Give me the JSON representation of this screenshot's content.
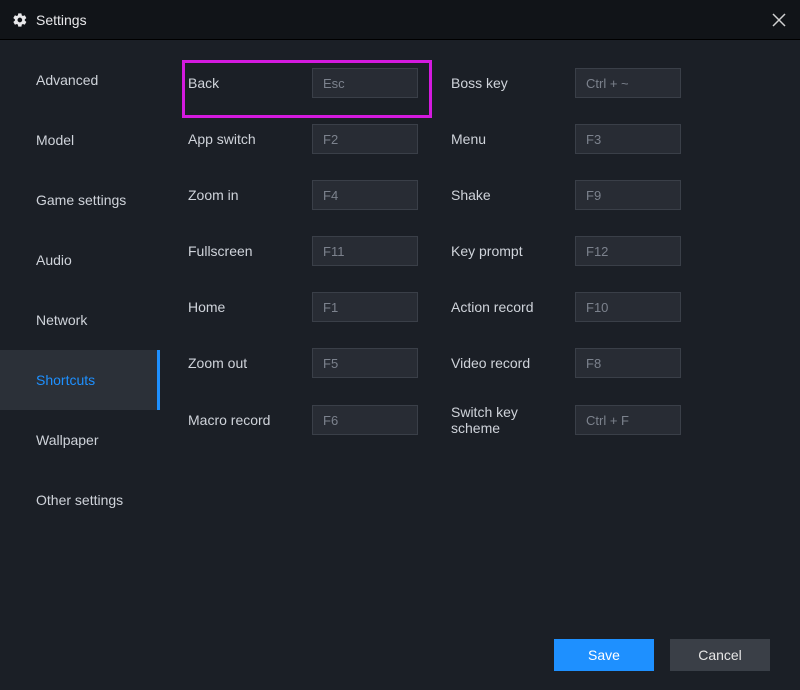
{
  "titlebar": {
    "title": "Settings"
  },
  "sidebar": {
    "items": [
      {
        "label": "Advanced"
      },
      {
        "label": "Model"
      },
      {
        "label": "Game settings"
      },
      {
        "label": "Audio"
      },
      {
        "label": "Network"
      },
      {
        "label": "Shortcuts"
      },
      {
        "label": "Wallpaper"
      },
      {
        "label": "Other settings"
      }
    ],
    "active_index": 5
  },
  "shortcuts": {
    "back": {
      "label": "Back",
      "value": "Esc"
    },
    "boss_key": {
      "label": "Boss key",
      "value": "Ctrl + ~"
    },
    "app_switch": {
      "label": "App switch",
      "value": "F2"
    },
    "menu": {
      "label": "Menu",
      "value": "F3"
    },
    "zoom_in": {
      "label": "Zoom in",
      "value": "F4"
    },
    "shake": {
      "label": "Shake",
      "value": "F9"
    },
    "fullscreen": {
      "label": "Fullscreen",
      "value": "F11"
    },
    "key_prompt": {
      "label": "Key prompt",
      "value": "F12"
    },
    "home": {
      "label": "Home",
      "value": "F1"
    },
    "action_record": {
      "label": "Action record",
      "value": "F10"
    },
    "zoom_out": {
      "label": "Zoom out",
      "value": "F5"
    },
    "video_record": {
      "label": "Video record",
      "value": "F8"
    },
    "macro_record": {
      "label": "Macro record",
      "value": "F6"
    },
    "switch_scheme": {
      "label": "Switch key scheme",
      "value": "Ctrl + F"
    }
  },
  "footer": {
    "save_label": "Save",
    "cancel_label": "Cancel"
  }
}
